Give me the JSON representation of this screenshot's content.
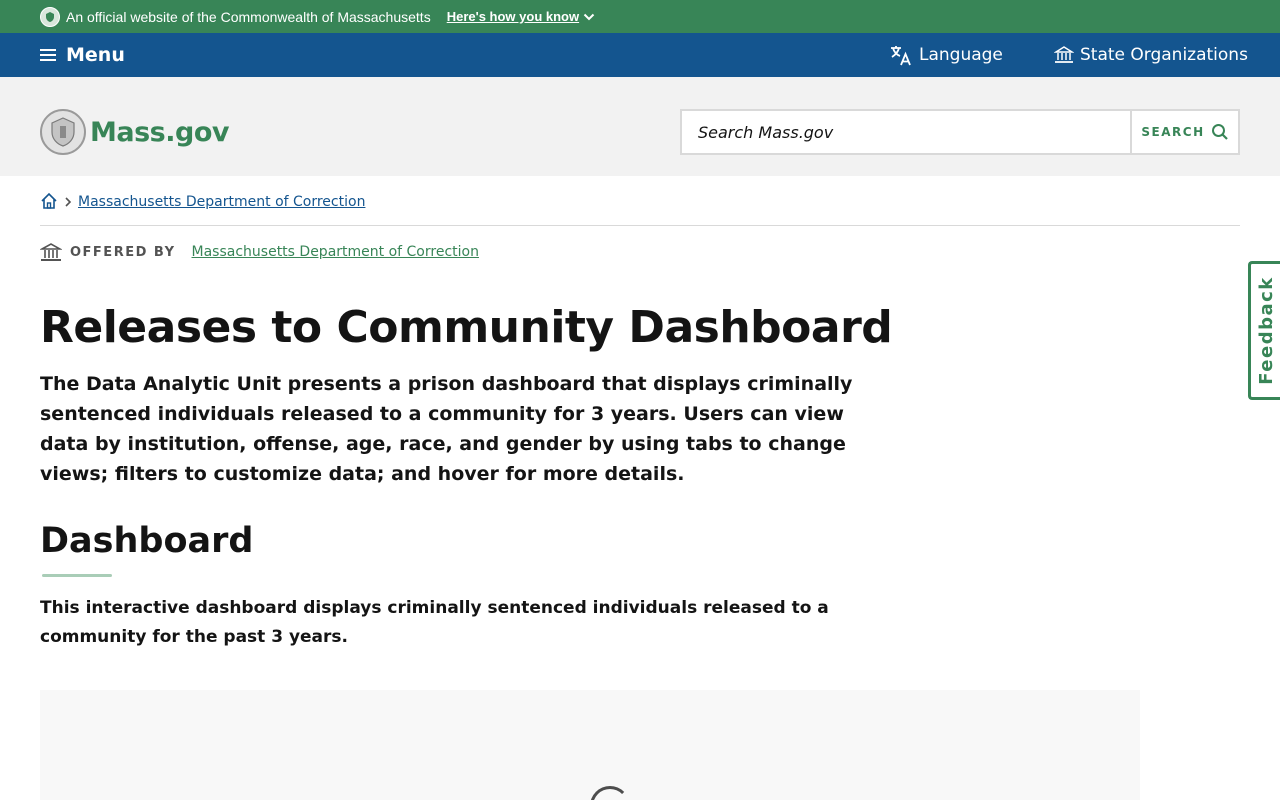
{
  "official_banner": {
    "text": "An official website of the Commonwealth of Massachusetts",
    "how_link": "Here's how you know"
  },
  "nav": {
    "menu_label": "Menu",
    "language_label": "Language",
    "state_orgs_label": "State Organizations"
  },
  "header": {
    "logo_text": "Mass.gov",
    "search_placeholder": "Search Mass.gov",
    "search_button": "SEARCH"
  },
  "breadcrumb": {
    "items": [
      "Massachusetts Department of Correction"
    ]
  },
  "offered_by": {
    "label": "OFFERED BY",
    "org": "Massachusetts Department of Correction"
  },
  "page": {
    "title": "Releases to Community Dashboard",
    "lead": "The Data Analytic Unit presents a prison dashboard that displays criminally sentenced individuals released to a community for 3 years. Users can view data by institution, offense, age, race, and gender by using tabs to change views; filters to customize data; and hover for more details.",
    "section_title": "Dashboard",
    "section_text": "This interactive dashboard displays criminally sentenced individuals released to a community for the past 3 years."
  },
  "feedback": {
    "label": "Feedback"
  },
  "colors": {
    "green": "#388557",
    "blue": "#14558f",
    "header_bg": "#f2f2f2"
  }
}
